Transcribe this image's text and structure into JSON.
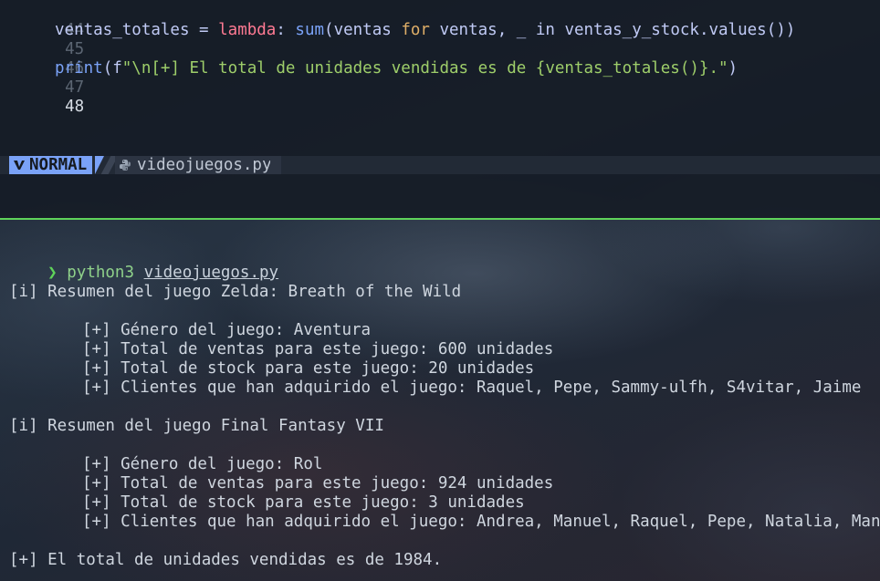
{
  "editor": {
    "lines": [
      {
        "num": "44",
        "text": ""
      },
      {
        "num": "45",
        "var": "ventas_totales",
        "eq": " = ",
        "kw": "lambda",
        "colon": ": ",
        "fn": "sum",
        "rest1": "(ventas ",
        "for": "for",
        "rest2": " ventas, _ in ventas_y_stock.values())"
      },
      {
        "num": "46",
        "text": ""
      },
      {
        "num": "47",
        "fn": "print",
        "pre": "(f",
        "str": "\"\\n[+] El total de unidades vendidas es de {ventas_totales()}.\"",
        "post": ")"
      },
      {
        "num": "48",
        "text": ""
      }
    ]
  },
  "statusline": {
    "mode": "NORMAL",
    "filename": "videojuegos.py",
    "mode_icon": "vim-icon",
    "file_icon": "python-icon"
  },
  "terminal": {
    "prompt_symbol": "❯",
    "command": "python3",
    "argument": "videojuegos.py",
    "game1_title": "[i] Resumen del juego Zelda: Breath of the Wild",
    "game1_lines": [
      "[+] Género del juego: Aventura",
      "[+] Total de ventas para este juego: 600 unidades",
      "[+] Total de stock para este juego: 20 unidades",
      "[+] Clientes que han adquirido el juego: Raquel, Pepe, Sammy-ulfh, S4vitar, Jaime"
    ],
    "game2_title": "[i] Resumen del juego Final Fantasy VII",
    "game2_lines": [
      "[+] Género del juego: Rol",
      "[+] Total de ventas para este juego: 924 unidades",
      "[+] Total de stock para este juego: 3 unidades",
      "[+] Clientes que han adquirido el juego: Andrea, Manuel, Raquel, Pepe, Natalia, Manolo"
    ],
    "total_line": "[+] El total de unidades vendidas es de 1984."
  },
  "colors": {
    "divider": "#5fd35a",
    "mode_bg": "#7aa2f7",
    "keyword": "#ff7a93",
    "string": "#9ece6a"
  }
}
